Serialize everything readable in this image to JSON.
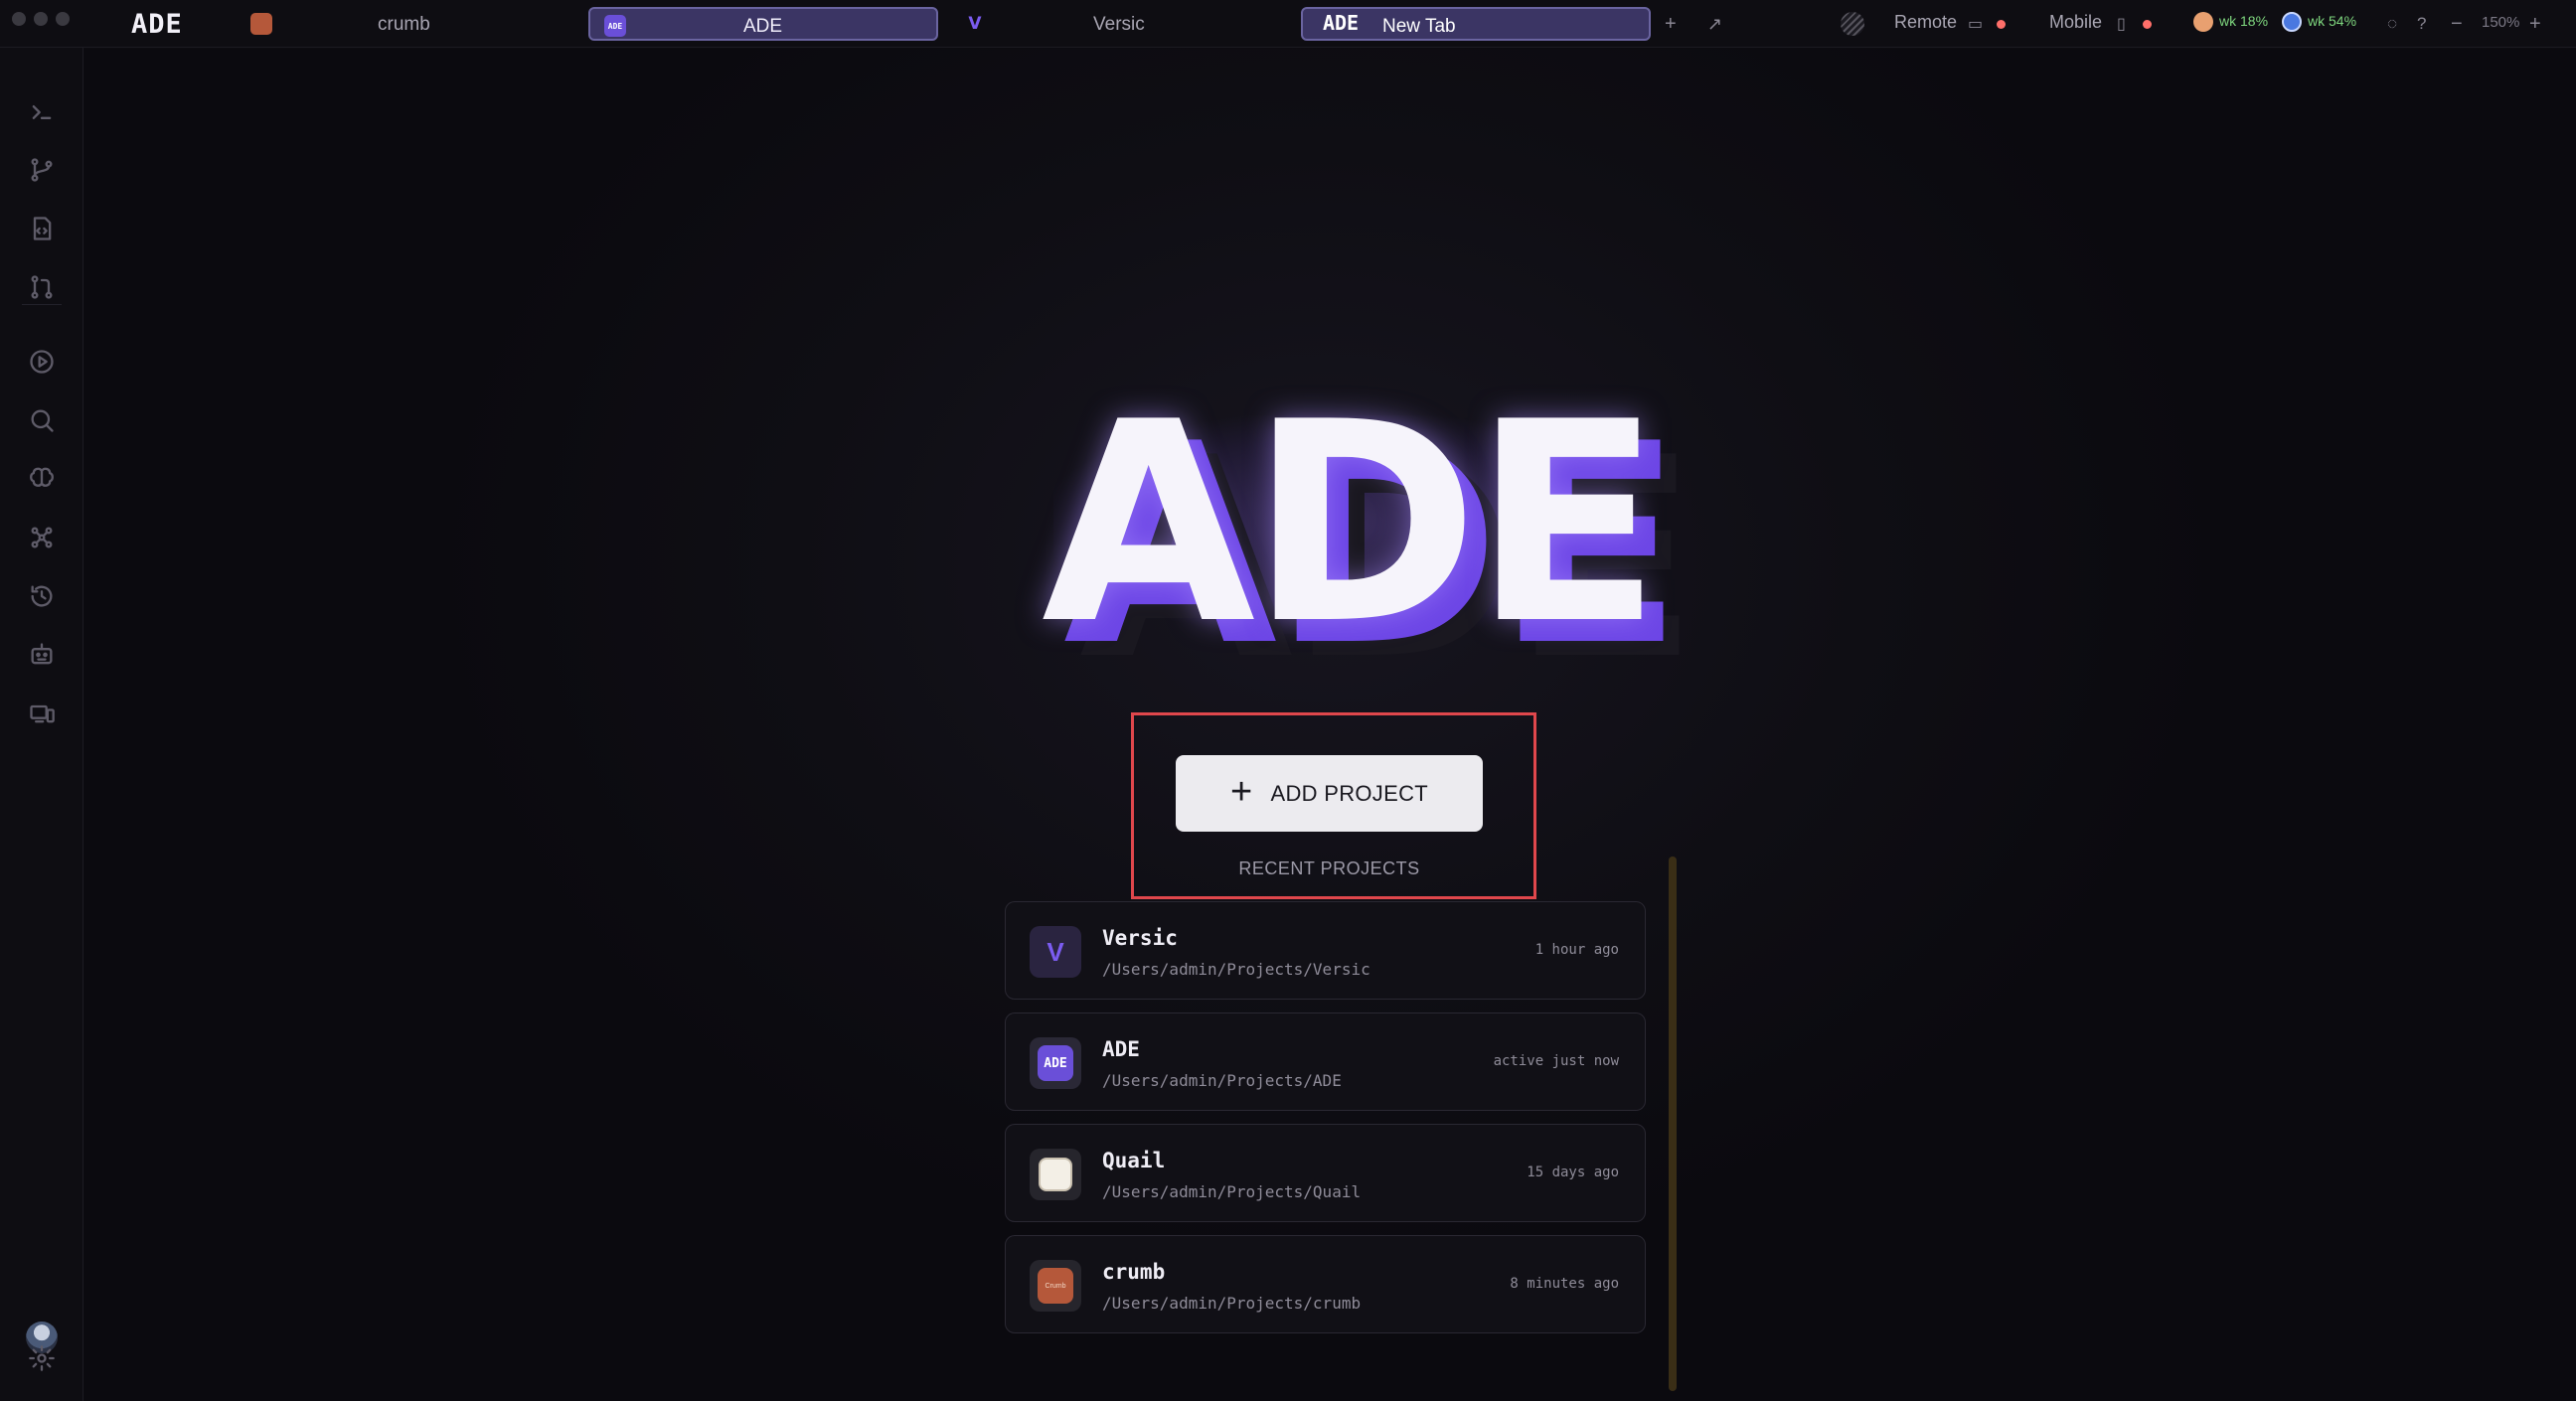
{
  "app": {
    "brand": "ADE"
  },
  "tabs": [
    {
      "label": "crumb",
      "icon": "crumb-app-icon",
      "active": false
    },
    {
      "label": "ADE",
      "icon": "ade-app-icon",
      "active": true
    },
    {
      "label": "Versic",
      "icon": "versic-app-icon",
      "active": false
    },
    {
      "label": "New Tab",
      "icon": "ade-logo-icon",
      "active": true
    }
  ],
  "tab_icons": {
    "ade_small": "ADE",
    "ade_big": "ADE",
    "versic": "V"
  },
  "status": {
    "remote_label": "Remote",
    "mobile_label": "Mobile",
    "usage1": "wk 18%",
    "usage2": "wk 54%",
    "zoom": "150%"
  },
  "sidebar": {
    "items": [
      "terminal-icon",
      "git-branch-icon",
      "file-code-icon",
      "pull-request-icon",
      "play-circle-icon",
      "search-icon",
      "brain-icon",
      "graph-nodes-icon",
      "history-icon",
      "robot-icon",
      "devices-icon"
    ],
    "settings": "gear-icon"
  },
  "hero": {
    "logo_text": "ADE"
  },
  "actions": {
    "add_project_label": "ADD PROJECT",
    "recent_title": "RECENT PROJECTS"
  },
  "projects": [
    {
      "name": "Versic",
      "path": "/Users/admin/Projects/Versic",
      "time": "1 hour ago",
      "icon_text": "V"
    },
    {
      "name": "ADE",
      "path": "/Users/admin/Projects/ADE",
      "time": "active just now",
      "icon_text": "ADE"
    },
    {
      "name": "Quail",
      "path": "/Users/admin/Projects/Quail",
      "time": "15 days ago",
      "icon_text": ""
    },
    {
      "name": "crumb",
      "path": "/Users/admin/Projects/crumb",
      "time": "8 minutes ago",
      "icon_text": "Crumb"
    }
  ],
  "colors": {
    "accent": "#6d46e6",
    "highlight": "#e0474c",
    "status_dot": "#ff6f6a",
    "usage": "#7fd87f"
  }
}
